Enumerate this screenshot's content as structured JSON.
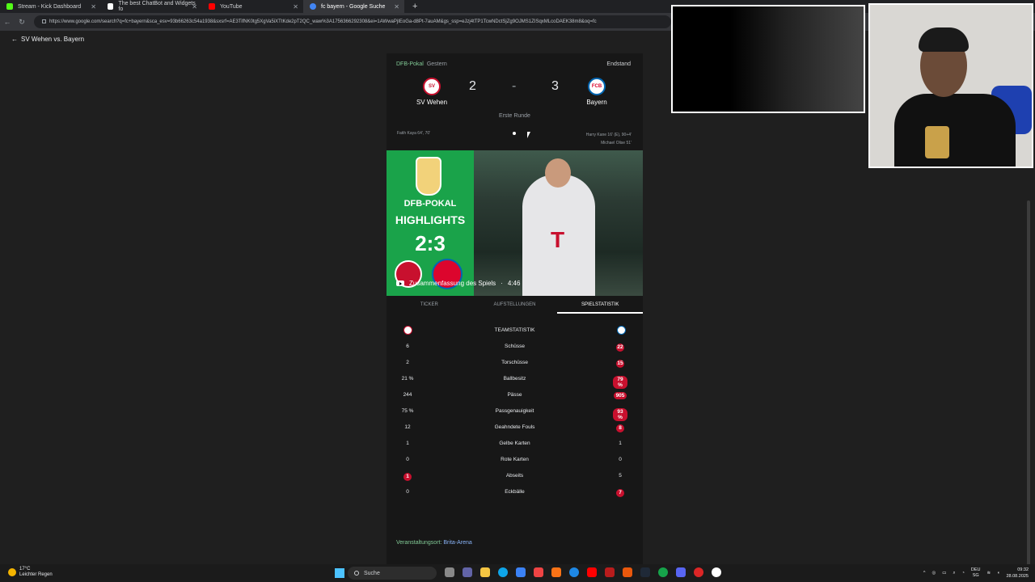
{
  "browser": {
    "tabs": [
      {
        "label": "Stream - Kick Dashboard",
        "color": "#53fc18"
      },
      {
        "label": "The best ChatBot and Widgets fo",
        "color": "#ffffff"
      },
      {
        "label": "YouTube",
        "color": "#ff0000"
      },
      {
        "label": "fc bayern - Google Suche",
        "color": "#4285f4",
        "active": true
      }
    ],
    "url": "https://www.google.com/search?q=fc+bayern&sca_esv=93b66263c54a1938&sxsrf=AE3TifNK0tg5XgVa5iXTtKde2pT2QC_waw%3A1756366292308&ei=1AWwaPjIEoGa-d8Pt-7auAM&gs_ssp=eJzj4tTP1TcwNDctSjZg9OJMS1ZISqxMLcoDAEK38m8&oq=fc"
  },
  "page": {
    "back_label": "SV Wehen vs. Bayern",
    "competition": "DFB-Pokal",
    "when": "Gestern",
    "status": "Endstand",
    "home": {
      "name": "SV Wehen",
      "score": "2",
      "scorers": "Fatih Kaya 64', 70'"
    },
    "away": {
      "name": "Bayern",
      "score": "3",
      "scorers_1": "Harry Kane 16' (E), 90+4'",
      "scorers_2": "Michael Olise 51'"
    },
    "separator": "-",
    "round": "Erste Runde",
    "highlight": {
      "line1": "DFB-POKAL",
      "line2": "HIGHLIGHTS",
      "line3": "2:3",
      "caption": "Zusammenfassung des Spiels",
      "duration": "4:46"
    },
    "tabs": [
      "TICKER",
      "AUFSTELLUNGEN",
      "SPIELSTATISTIK"
    ],
    "stats_header": "TEAMSTATISTIK",
    "stats": [
      {
        "label": "Schüsse",
        "home": "6",
        "away": "22",
        "lead": "away"
      },
      {
        "label": "Torschüsse",
        "home": "2",
        "away": "15",
        "lead": "away"
      },
      {
        "label": "Ballbesitz",
        "home": "21 %",
        "away": "79 %",
        "lead": "away"
      },
      {
        "label": "Pässe",
        "home": "244",
        "away": "905",
        "lead": "away"
      },
      {
        "label": "Passgenauigkeit",
        "home": "75 %",
        "away": "93 %",
        "lead": "away"
      },
      {
        "label": "Geahndete Fouls",
        "home": "12",
        "away": "8",
        "lead": "away"
      },
      {
        "label": "Gelbe Karten",
        "home": "1",
        "away": "1",
        "lead": "none"
      },
      {
        "label": "Rote Karten",
        "home": "0",
        "away": "0",
        "lead": "none"
      },
      {
        "label": "Abseits",
        "home": "1",
        "away": "5",
        "lead": "home"
      },
      {
        "label": "Eckbälle",
        "home": "0",
        "away": "7",
        "lead": "away"
      }
    ],
    "venue_label": "Veranstaltungsort:",
    "venue": "Brita-Arena"
  },
  "taskbar": {
    "temp": "17°C",
    "weather": "Leichter Regen",
    "search": "Suche",
    "lang1": "DEU",
    "lang2": "SG",
    "time": "09:32",
    "date": "28.08.2025"
  },
  "colors": {
    "accent_red": "#c8102e",
    "comp_green": "#81c995",
    "link_blue": "#8ab4f8"
  }
}
